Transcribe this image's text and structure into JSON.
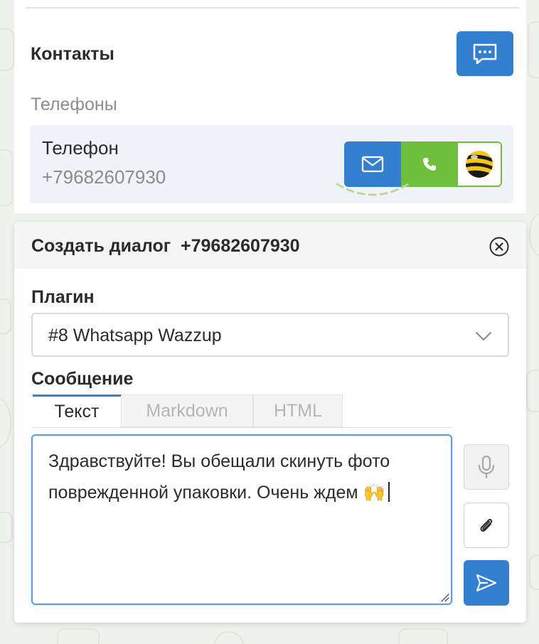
{
  "contacts": {
    "title": "Контакты",
    "phones_label": "Телефоны",
    "phone": {
      "type": "Телефон",
      "number": "+79682607930"
    },
    "actions": [
      "mail-icon",
      "phone-icon",
      "operator-logo-icon"
    ]
  },
  "dialog": {
    "title": "Создать диалог  +79682607930",
    "plugin_label": "Плагин",
    "plugin_value": "#8 Whatsapp Wazzup",
    "message_label": "Сообщение",
    "tabs": [
      {
        "label": "Текст",
        "active": true
      },
      {
        "label": "Markdown",
        "active": false
      },
      {
        "label": "HTML",
        "active": false
      }
    ],
    "message_text": "Здравствуйте! Вы обещали скинуть фото поврежденной упаковки. Очень ждем",
    "message_emoji": "🙌"
  },
  "colors": {
    "primary": "#3380d0",
    "call_green": "#6fc03c",
    "header_bg": "#f5f5f5",
    "card_bg": "#eff3f7"
  }
}
